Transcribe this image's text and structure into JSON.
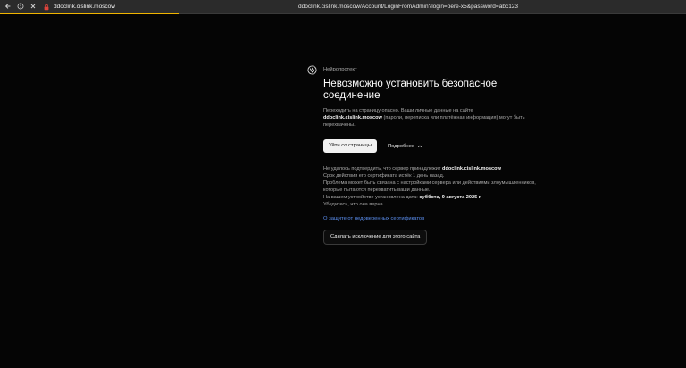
{
  "browser": {
    "tab_title": "ddoclink.cislink.moscow",
    "url": "ddoclink.cislink.moscow/Account/LoginFromAdmin?login=pere-x5&password=abc123",
    "load_progress": 0.26,
    "accent_color": "#f0b400",
    "lock_color": "#e0443c"
  },
  "warning": {
    "brand": "Нейропротект",
    "title": "Невозможно установить безопасное соединение",
    "desc_prefix": "Переходить на страницу опасно. Ваши личные данные на сайте",
    "desc_domain": "ddoclink.cislink.moscow",
    "desc_suffix": "(пароли, переписка или платёжная информация) могут быть перехвачены.",
    "leave_button": "Уйти со страницы",
    "details_toggle": "Подробнее",
    "details": {
      "line1_prefix": "Не удалось подтвердить, что сервер принадлежит",
      "line1_domain": "ddoclink.cislink.moscow",
      "line2": "Срок действия его сертификата истёк 1 день назад.",
      "line3": "Проблема может быть связана с настройками сервера или действиями злоумышленников, которые пытаются перехватить ваши данные.",
      "line4_prefix": "На вашем устройстве установлена дата:",
      "line4_date": "суббота, 9 августа 2025 г.",
      "line5": "Убедитесь, что она верна."
    },
    "cert_link": "О защите от недоверенных сертификатов",
    "exception_button": "Сделать исключение для этого сайта",
    "link_color": "#5b8ff0"
  }
}
